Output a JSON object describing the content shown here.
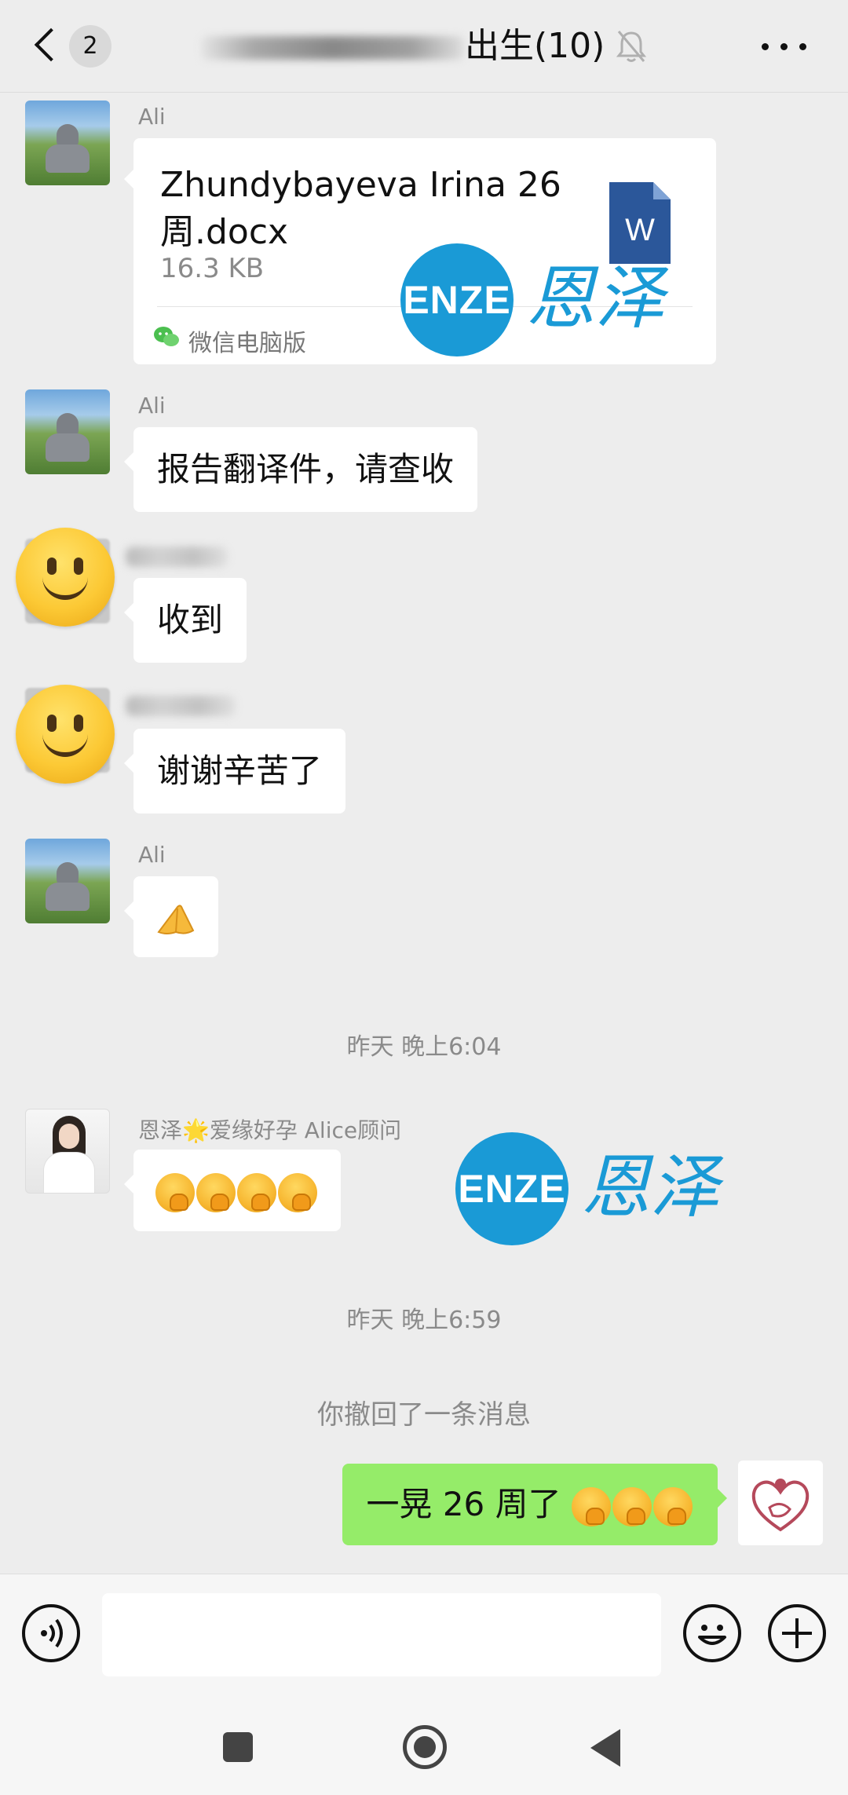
{
  "header": {
    "unread_count": "2",
    "title": "出生(10)",
    "icons": [
      "back-chevron-icon",
      "bell-muted-icon",
      "more-icon"
    ]
  },
  "messages": [
    {
      "sender": "Ali",
      "type": "file",
      "file_name": "Zhundybayeva Irina 26周.docx",
      "file_size": "16.3 KB",
      "file_icon": "W",
      "source": "微信电脑版"
    },
    {
      "sender": "Ali",
      "type": "text",
      "text": "报告翻译件，请查收"
    },
    {
      "sender": "",
      "type": "text",
      "text": "收到"
    },
    {
      "sender": "",
      "type": "text",
      "text": "谢谢辛苦了"
    },
    {
      "sender": "Ali",
      "type": "emoji",
      "emoji": "pray-emoji"
    }
  ],
  "time_1": "昨天 晚上6:04",
  "alice_message": {
    "sender": "恩泽🌟爱缘好孕 Alice顾问",
    "emoji": "face-with-hand-over-mouth x4"
  },
  "time_2": "昨天 晚上6:59",
  "recall_notice": "你撤回了一条消息",
  "my_message": {
    "text": "一晃 26 周了",
    "emoji": "face-with-hand-over-mouth x3"
  },
  "watermark": {
    "latin": "ENZE",
    "chinese": "恩泽",
    "color": "#1a9ad6"
  },
  "input_bar": {
    "placeholder": "",
    "icons": [
      "voice-icon",
      "emoji-icon",
      "plus-icon"
    ]
  },
  "colors": {
    "bubble_mine": "#95ec69",
    "background": "#ededed",
    "word_blue": "#2b579a"
  }
}
